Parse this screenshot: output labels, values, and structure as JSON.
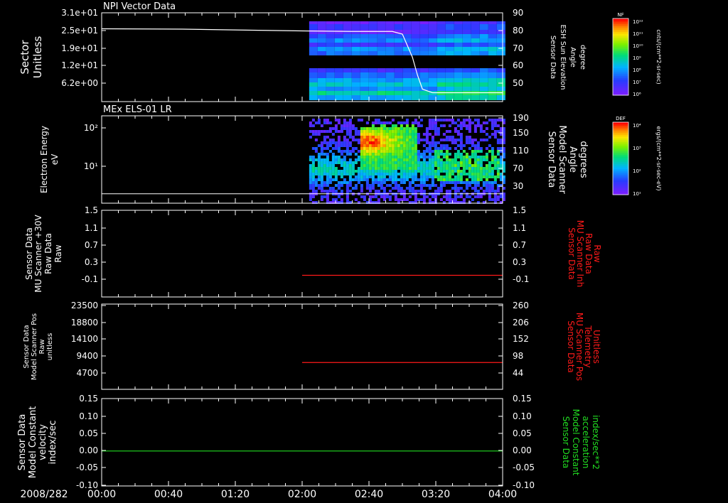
{
  "colors": {
    "background": "#000000",
    "axis": "#ffffff",
    "red_trace": "#ff1a1a",
    "green_trace": "#22dd22",
    "white_trace": "#ffffff"
  },
  "time_axis": {
    "date_label": "2008/282",
    "ticks": [
      "00:00",
      "00:40",
      "01:20",
      "02:00",
      "02:40",
      "03:20",
      "04:00"
    ],
    "tick_hours": [
      0,
      0.6667,
      1.3333,
      2.0,
      2.6667,
      3.3333,
      4.0
    ],
    "range_hours": [
      0,
      4.0
    ]
  },
  "chart_data": [
    {
      "type": "heatmap",
      "title": "NPI Vector Data",
      "ylabel": [
        "Sector",
        "Unitless"
      ],
      "yticks": [
        "3.1e+01",
        "2.5e+01",
        "1.9e+01",
        "1.2e+01",
        "6.2e+00"
      ],
      "ylim": [
        0,
        31
      ],
      "data_start_hour": 2.07,
      "y2label": [
        "Sensor Data",
        "ESH Sun Elevation",
        "Angle",
        "degree"
      ],
      "y2ticks": [
        "90",
        "80",
        "70",
        "60",
        "50"
      ],
      "y2lim": [
        40,
        90
      ],
      "overlay_line": {
        "name": "ESH Sun Elevation Angle",
        "x_hours": [
          0,
          0.8,
          1.5,
          2.0,
          2.5,
          2.9,
          3.0,
          3.1,
          3.15,
          3.2,
          3.3,
          4.0
        ],
        "y": [
          81,
          80.8,
          80.2,
          79.8,
          79.5,
          79.5,
          78,
          65,
          55,
          47,
          45,
          45
        ]
      },
      "colorbar": {
        "label": "NF",
        "units": "cnts/(cm**2-sr-sec)",
        "ticks": [
          "10¹²",
          "10¹¹",
          "10¹⁰",
          "10⁹",
          "10⁸",
          "10⁷",
          "10⁶"
        ]
      }
    },
    {
      "type": "heatmap",
      "title": "MEx ELS-01 LR",
      "ylabel": [
        "Electron Energy",
        "eV"
      ],
      "yticks": [
        "10²",
        "10¹"
      ],
      "data_start_hour": 2.07,
      "y2label": [
        "Sensor Data",
        "Model Scanner",
        "Angle",
        "degrees"
      ],
      "y2ticks": [
        "190",
        "150",
        "110",
        "70",
        "30"
      ],
      "y2lim": [
        0,
        190
      ],
      "overlay_line": {
        "name": "Model Scanner Angle",
        "x_hours": [
          0,
          4.0
        ],
        "y": [
          5,
          5
        ]
      },
      "colorbar": {
        "label": "DEF",
        "units": "ergs/(cm**2-sr-sec-eV)",
        "ticks": [
          "10⁴",
          "10³",
          "10²",
          "10¹"
        ]
      }
    },
    {
      "type": "line",
      "ylabel": [
        "Sensor Data",
        "MU Scanner +30V",
        "Raw Data",
        "Raw"
      ],
      "yticks": [
        "1.5",
        "1.1",
        "0.7",
        "0.3",
        "-0.1"
      ],
      "ylim": [
        -0.5,
        1.5
      ],
      "y2label": [
        "Sensor Data",
        "MU Scanner Inh",
        "Raw Data",
        "Raw"
      ],
      "y2ticks": [
        "1.5",
        "1.1",
        "0.7",
        "0.3",
        "-0.1"
      ],
      "series": [
        {
          "x_hours": [
            2.0,
            4.0
          ],
          "y": [
            0.0,
            0.0
          ]
        }
      ]
    },
    {
      "type": "line",
      "ylabel": [
        "Sensor Data",
        "Model Scanner Pos",
        "Raw",
        "unitless"
      ],
      "yticks": [
        "23500",
        "18800",
        "14100",
        "9400",
        "4700"
      ],
      "ylim": [
        0,
        23500
      ],
      "y2label": [
        "Sensor Data",
        "MU Scanner Pos",
        "Telemetry",
        "Unitless"
      ],
      "y2ticks": [
        "260",
        "206",
        "152",
        "98",
        "44"
      ],
      "y2lim": [
        0,
        260
      ],
      "series": [
        {
          "x_hours": [
            2.0,
            4.0
          ],
          "y": [
            7400,
            7400
          ]
        }
      ]
    },
    {
      "type": "line",
      "ylabel": [
        "Sensor Data",
        "Model Constant",
        "velocity",
        "index/sec"
      ],
      "yticks": [
        "0.15",
        "0.10",
        "0.05",
        "0.00",
        "-0.05",
        "-0.10"
      ],
      "ylim": [
        -0.1,
        0.15
      ],
      "y2label": [
        "Sensor Data",
        "Model Constant",
        "acceleration",
        "index/sec**2"
      ],
      "y2ticks": [
        "0.15",
        "0.10",
        "0.05",
        "0.00",
        "-0.05",
        "-0.10"
      ],
      "series": [
        {
          "x_hours": [
            0,
            4.0
          ],
          "y": [
            0.0,
            0.0
          ]
        }
      ]
    }
  ]
}
